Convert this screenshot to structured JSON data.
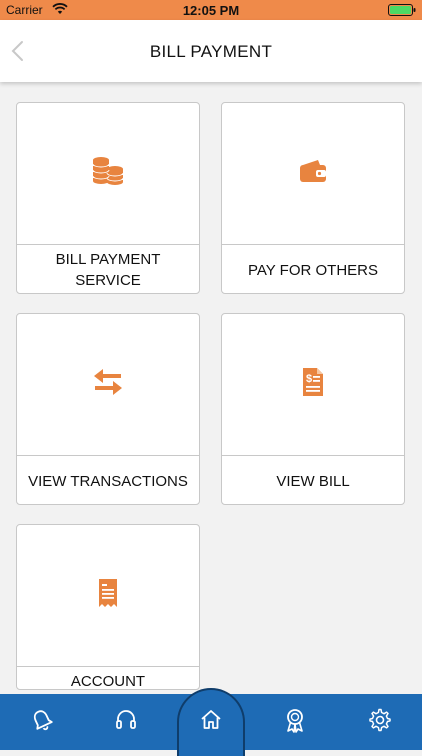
{
  "status_bar": {
    "carrier": "Carrier",
    "time": "12:05 PM"
  },
  "header": {
    "title": "BILL PAYMENT"
  },
  "tiles": [
    {
      "label": "BILL PAYMENT SERVICE",
      "icon": "coins-icon"
    },
    {
      "label": "PAY FOR OTHERS",
      "icon": "wallet-icon"
    },
    {
      "label": "VIEW TRANSACTIONS",
      "icon": "transfer-arrows-icon"
    },
    {
      "label": "VIEW BILL",
      "icon": "bill-document-icon"
    },
    {
      "label": "ACCOUNT",
      "icon": "receipt-icon"
    }
  ],
  "tab_bar": {
    "items": [
      "bell-icon",
      "headset-icon",
      "home-icon",
      "award-icon",
      "gear-icon"
    ],
    "active": "home-icon"
  },
  "colors": {
    "status_bar": "#ef8a4a",
    "accent_orange": "#e8843f",
    "tab_bar": "#1e6bb5",
    "background": "#f2f2f2"
  }
}
